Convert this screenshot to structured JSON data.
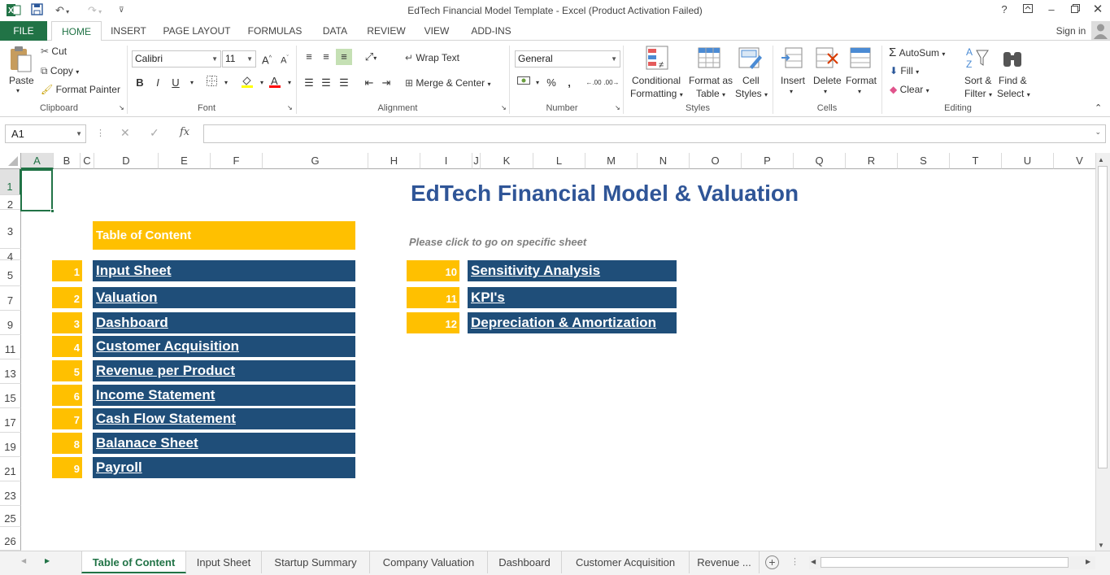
{
  "window": {
    "title": "EdTech Financial Model Template - Excel (Product Activation Failed)",
    "help": "?",
    "sign_in": "Sign in"
  },
  "ribbon_tabs": [
    "FILE",
    "HOME",
    "INSERT",
    "PAGE LAYOUT",
    "FORMULAS",
    "DATA",
    "REVIEW",
    "VIEW",
    "ADD-INS"
  ],
  "clipboard": {
    "paste": "Paste",
    "cut": "Cut",
    "copy": "Copy",
    "format_painter": "Format Painter",
    "label": "Clipboard"
  },
  "font": {
    "name": "Calibri",
    "size": "11",
    "bold": "B",
    "italic": "I",
    "underline": "U",
    "label": "Font"
  },
  "alignment": {
    "wrap_text": "Wrap Text",
    "merge_center": "Merge & Center",
    "label": "Alignment"
  },
  "number": {
    "format": "General",
    "percent": "%",
    "comma": ",",
    "label": "Number"
  },
  "styles": {
    "conditional": "Conditional",
    "conditional2": "Formatting",
    "format_as": "Format as",
    "format_as2": "Table",
    "cell": "Cell",
    "cell2": "Styles",
    "label": "Styles"
  },
  "cells": {
    "insert": "Insert",
    "delete": "Delete",
    "format": "Format",
    "label": "Cells"
  },
  "editing": {
    "autosum": "AutoSum",
    "fill": "Fill",
    "clear": "Clear",
    "sort": "Sort &",
    "sort2": "Filter",
    "find": "Find &",
    "find2": "Select",
    "label": "Editing"
  },
  "formula_bar": {
    "name_box": "A1",
    "fx": "fx",
    "formula": ""
  },
  "columns": [
    "A",
    "B",
    "C",
    "D",
    "E",
    "F",
    "G",
    "H",
    "I",
    "J",
    "K",
    "L",
    "M",
    "N",
    "O",
    "P",
    "Q",
    "R",
    "S",
    "T",
    "U",
    "V"
  ],
  "rows": [
    "1",
    "2",
    "3",
    "4",
    "5",
    "7",
    "9",
    "11",
    "13",
    "15",
    "17",
    "19",
    "21",
    "23",
    "25",
    "26"
  ],
  "sheet": {
    "title": "EdTech Financial Model & Valuation",
    "toc_header": "Table of Content",
    "hint": "Please click to go on specific sheet",
    "left_items": [
      {
        "num": "1",
        "label": "Input Sheet"
      },
      {
        "num": "2",
        "label": "Valuation"
      },
      {
        "num": "3",
        "label": "Dashboard"
      },
      {
        "num": "4",
        "label": "Customer Acquisition"
      },
      {
        "num": "5",
        "label": "Revenue per Product"
      },
      {
        "num": "6",
        "label": "Income Statement"
      },
      {
        "num": "7",
        "label": "Cash Flow Statement"
      },
      {
        "num": "8",
        "label": "Balanace Sheet"
      },
      {
        "num": "9",
        "label": "Payroll"
      }
    ],
    "right_items": [
      {
        "num": "10",
        "label": "Sensitivity Analysis"
      },
      {
        "num": "11",
        "label": "KPI's"
      },
      {
        "num": "12",
        "label": "Depreciation & Amortization"
      }
    ],
    "colors": {
      "navy": "#1f4e79",
      "gold": "#ffc000",
      "title": "#2f5597",
      "excel_green": "#217346"
    }
  },
  "sheet_tabs": [
    "Table of Content",
    "Input Sheet",
    "Startup Summary",
    "Company Valuation",
    "Dashboard",
    "Customer Acquisition",
    "Revenue ..."
  ]
}
